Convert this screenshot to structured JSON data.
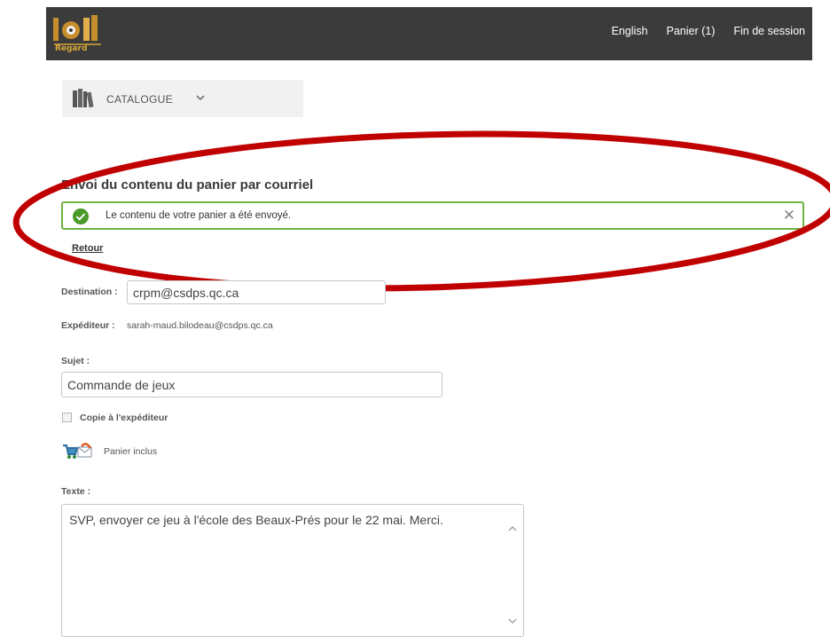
{
  "header": {
    "logo_text": "Regard",
    "nav": [
      "English",
      "Panier (1)",
      "Fin de session"
    ]
  },
  "catalogue": {
    "label": "CATALOGUE",
    "icon": "books-icon"
  },
  "page": {
    "title": "Envoi du contenu du panier par courriel",
    "alert_message": "Le contenu de votre panier a été envoyé.",
    "back_link": "Retour"
  },
  "form": {
    "destination_label": "Destination :",
    "destination_value": "crpm@csdps.qc.ca",
    "sender_label": "Expéditeur :",
    "sender_value": "sarah-maud.bilodeau@csdps.qc.ca",
    "subject_label": "Sujet :",
    "subject_value": "Commande de jeux",
    "copy_label": "Copie à l'expéditeur",
    "copy_checked": false,
    "cart_included_label": "Panier inclus",
    "text_label": "Texte :",
    "text_value": "SVP, envoyer ce jeu à l'école des Beaux-Prés pour le 22 mai. Merci."
  },
  "colors": {
    "topbar": "#3b3b3b",
    "alert_border": "#6cb342",
    "check_icon": "#4a9a2a",
    "highlight_ellipse": "#c00000"
  }
}
